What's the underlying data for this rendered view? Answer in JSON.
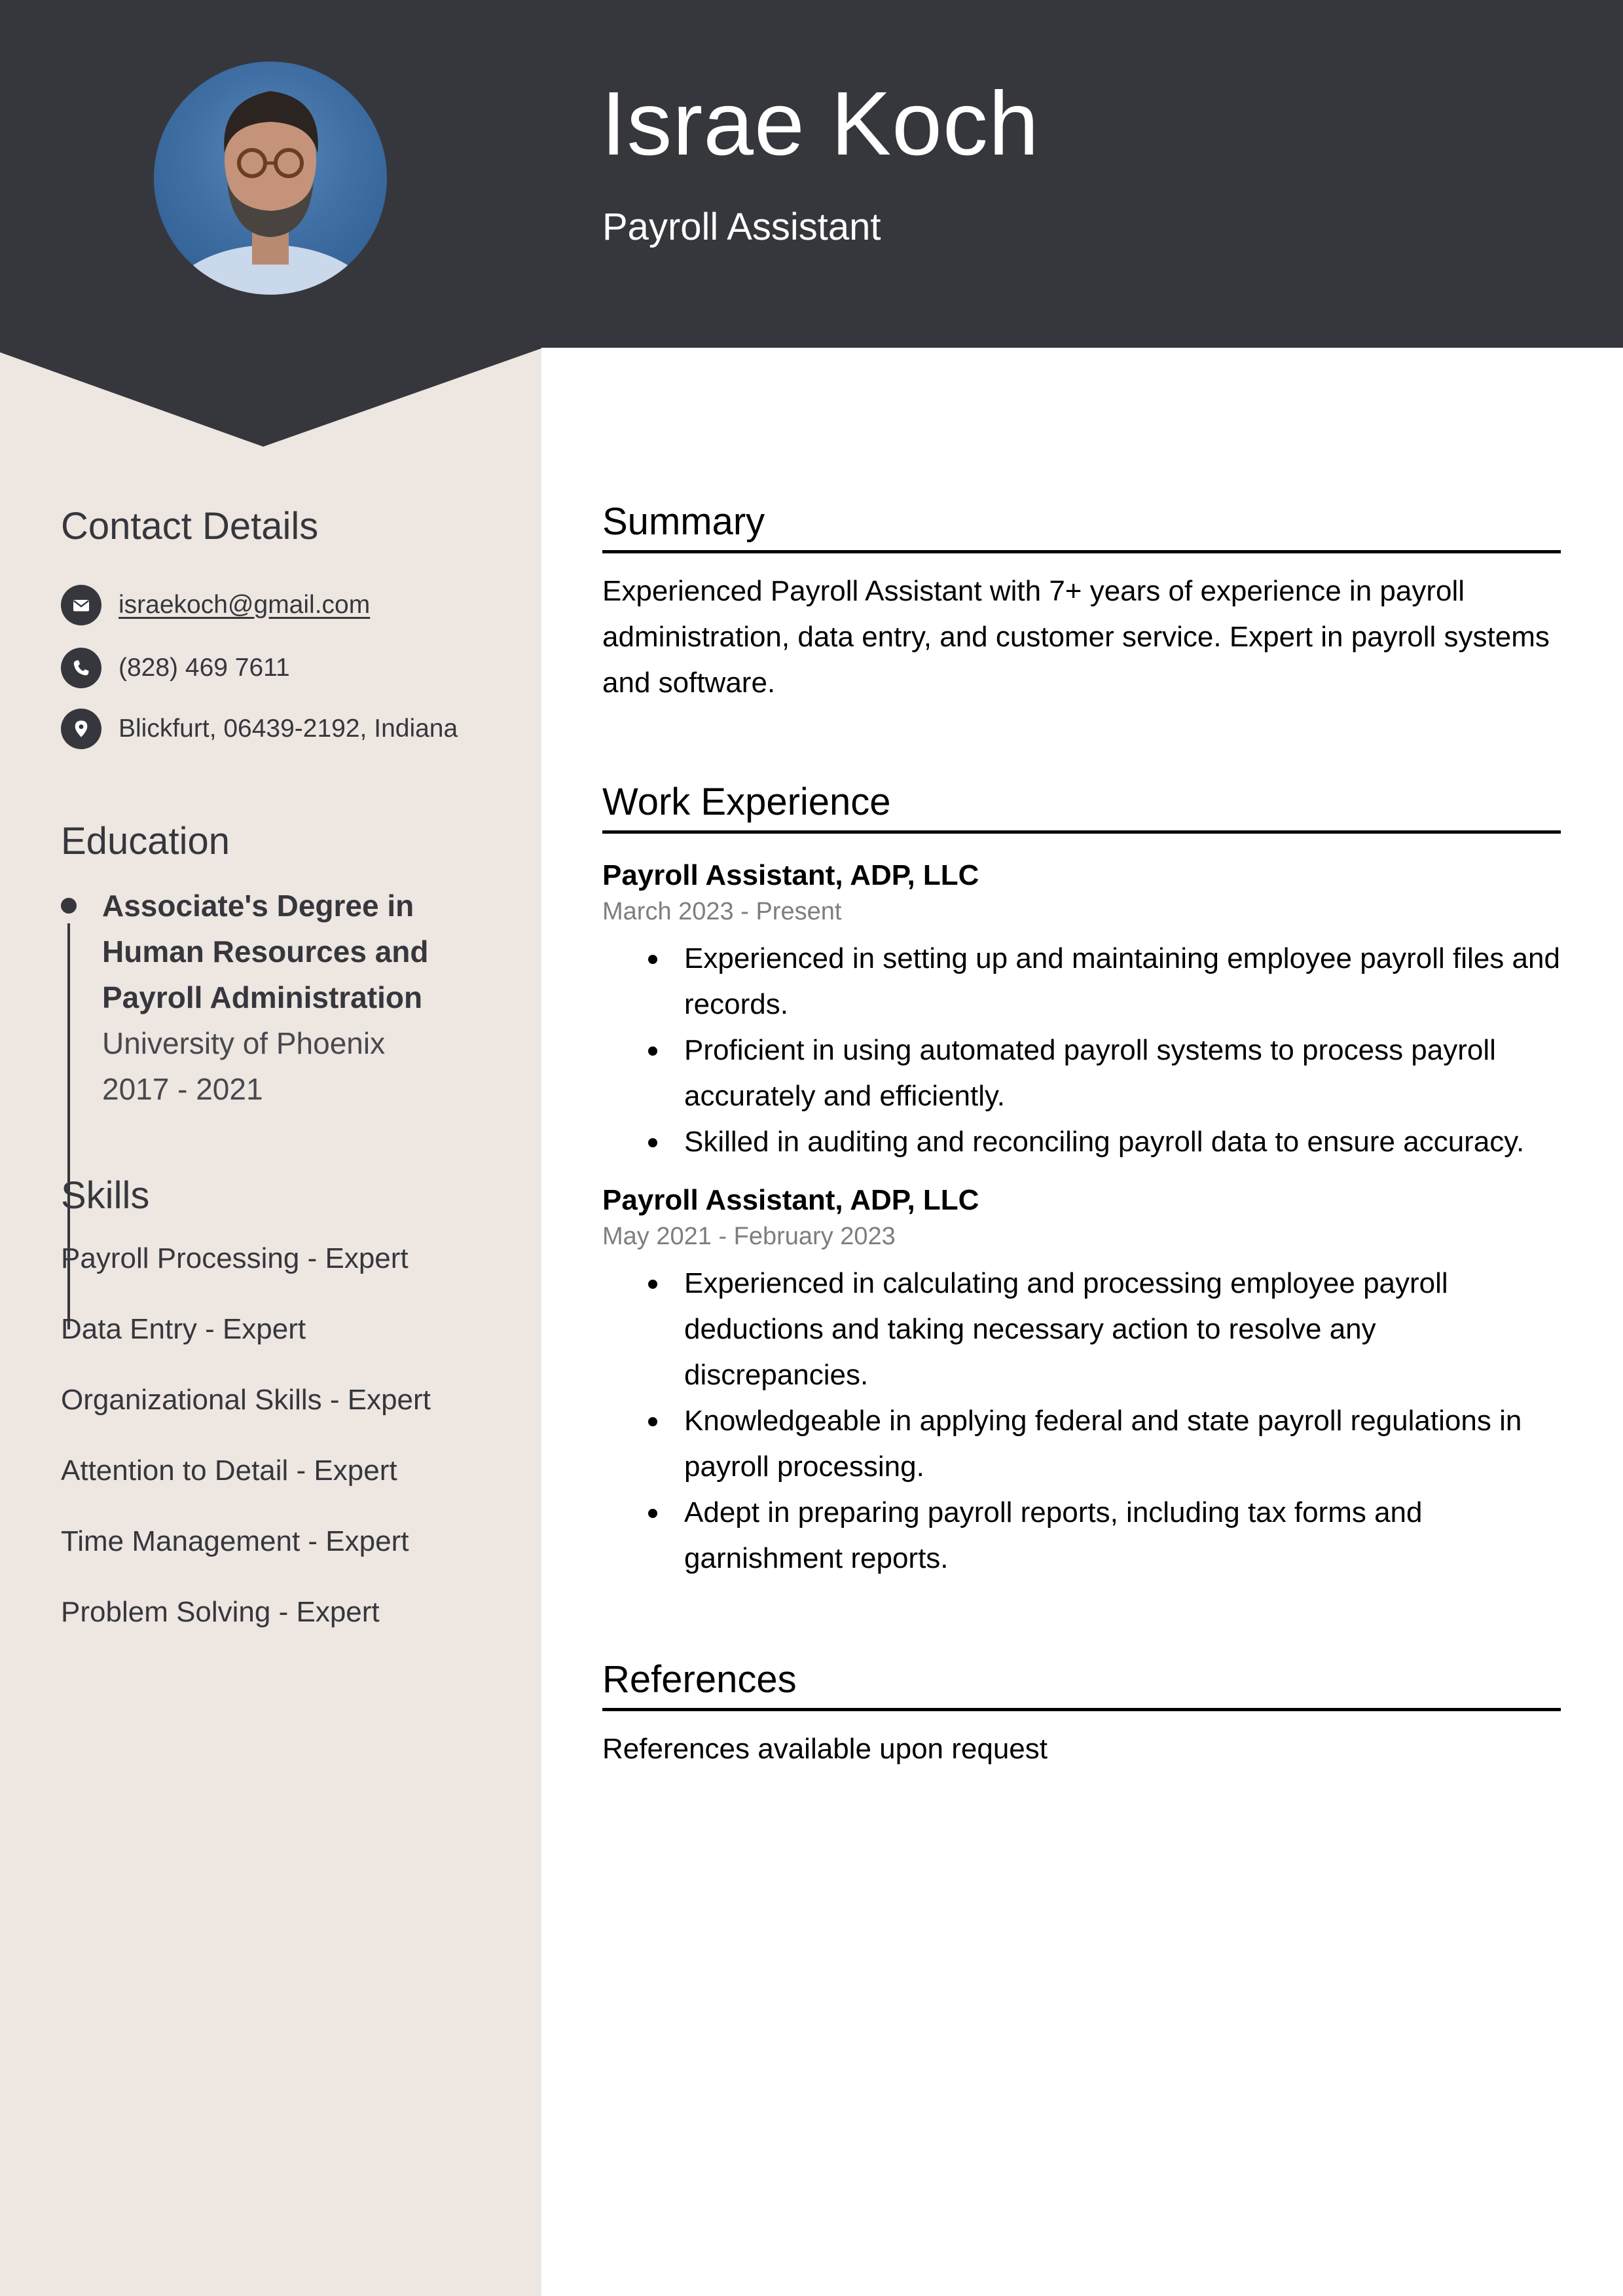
{
  "header": {
    "name": "Israe Koch",
    "title": "Payroll Assistant",
    "photo_alt": "profile-photo"
  },
  "colors": {
    "header_bg": "#36373d",
    "sidebar_bg": "#ede6e1",
    "text_dark": "#36373d",
    "date_gray": "#7e7e7e"
  },
  "sidebar": {
    "contact": {
      "heading": "Contact Details",
      "items": [
        {
          "icon": "envelope-icon",
          "text": "israekoch@gmail.com"
        },
        {
          "icon": "phone-icon",
          "text": "(828) 469 7611"
        },
        {
          "icon": "location-pin-icon",
          "text": "Blickfurt, 06439-2192, Indiana"
        }
      ]
    },
    "education": {
      "heading": "Education",
      "degree": "Associate's Degree in Human Resources and Payroll Administration",
      "school": "University of Phoenix",
      "years": "2017 - 2021"
    },
    "skills": {
      "heading": "Skills",
      "items": [
        "Payroll Processing - Expert",
        "Data Entry - Expert",
        "Organizational Skills - Expert",
        "Attention to Detail - Expert",
        "Time Management - Expert",
        "Problem Solving - Expert"
      ]
    }
  },
  "main": {
    "summary": {
      "heading": "Summary",
      "text": "Experienced Payroll Assistant with 7+ years of experience in payroll administration, data entry, and customer service. Expert in payroll systems and software."
    },
    "experience": {
      "heading": "Work Experience",
      "jobs": [
        {
          "title": "Payroll Assistant, ADP, LLC",
          "dates": "March 2023 - Present",
          "bullets": [
            "Experienced in setting up and maintaining employee payroll files and records.",
            "Proficient in using automated payroll systems to process payroll accurately and efficiently.",
            "Skilled in auditing and reconciling payroll data to ensure accuracy."
          ]
        },
        {
          "title": "Payroll Assistant, ADP, LLC",
          "dates": "May 2021 - February 2023",
          "bullets": [
            "Experienced in calculating and processing employee payroll deductions and taking necessary action to resolve any discrepancies.",
            "Knowledgeable in applying federal and state payroll regulations in payroll processing.",
            "Adept in preparing payroll reports, including tax forms and garnishment reports."
          ]
        }
      ]
    },
    "references": {
      "heading": "References",
      "text": "References available upon request"
    }
  }
}
